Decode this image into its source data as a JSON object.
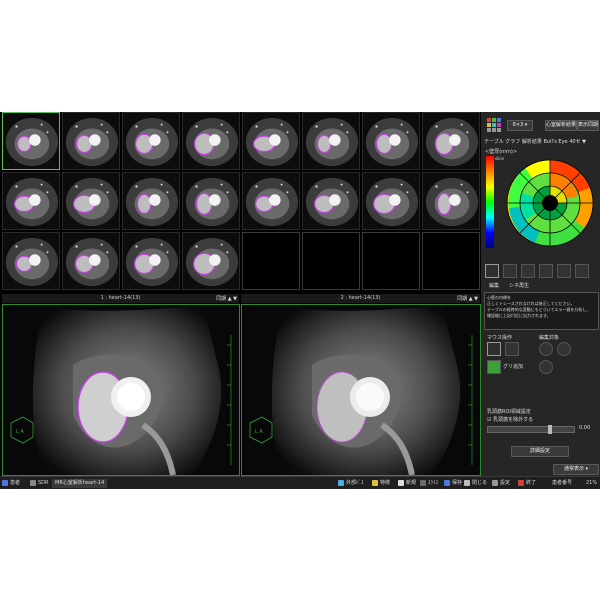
{
  "thumbnails": {
    "count": 20
  },
  "viewer": {
    "left_header": "1 : heart-14(13)",
    "right_header": "2 : heart-14(13)",
    "left_sync": "同期",
    "right_sync": "同期"
  },
  "panel": {
    "grid_dropdown": "8×3",
    "btn_analysis_result": "心室解析結果",
    "btn_display_sync": "表示同期",
    "tab_row": "テーブル  グラフ  解析結果  Bull's Eye  40セ ▼",
    "colorbar_label": "<壁厚(mm)>",
    "colorbar_unit": "slice",
    "edit_tab": "編集",
    "cine_tab": "シネ再生",
    "message": "心壁の内側を\n正しくトレースされなければ修正してください。\nテーブルの経時的な変動にもとづいてエラー値を分析し、\n確認後に上記付近に出力されます。",
    "mouse_ops": "マウス操作",
    "edit_tools": "編集対象",
    "trace_label": "グリ追加",
    "apply_roi": "乳頭筋ROI領域設定",
    "include_roi": "☑ 乳頭筋を除外する",
    "slider_value": "0.00",
    "detail_btn": "詳細設定",
    "normal_display": "通常表示"
  },
  "taskbar": {
    "start": "患者",
    "tab1": "SDR",
    "tab2": "MR心室解析heart-14",
    "t1": "外部ﾊﾞｽ",
    "t2": "特徴",
    "t3": "新規",
    "t4": "ｽﾗｲｽ",
    "t5": "保存",
    "t6": "閉じる",
    "t7": "設定",
    "t8": "終了",
    "status": "患者番号",
    "percent": "21%"
  },
  "colors": {
    "accent_green": "#3aa03a",
    "contour": "#c040e0",
    "panel": "#262626"
  }
}
